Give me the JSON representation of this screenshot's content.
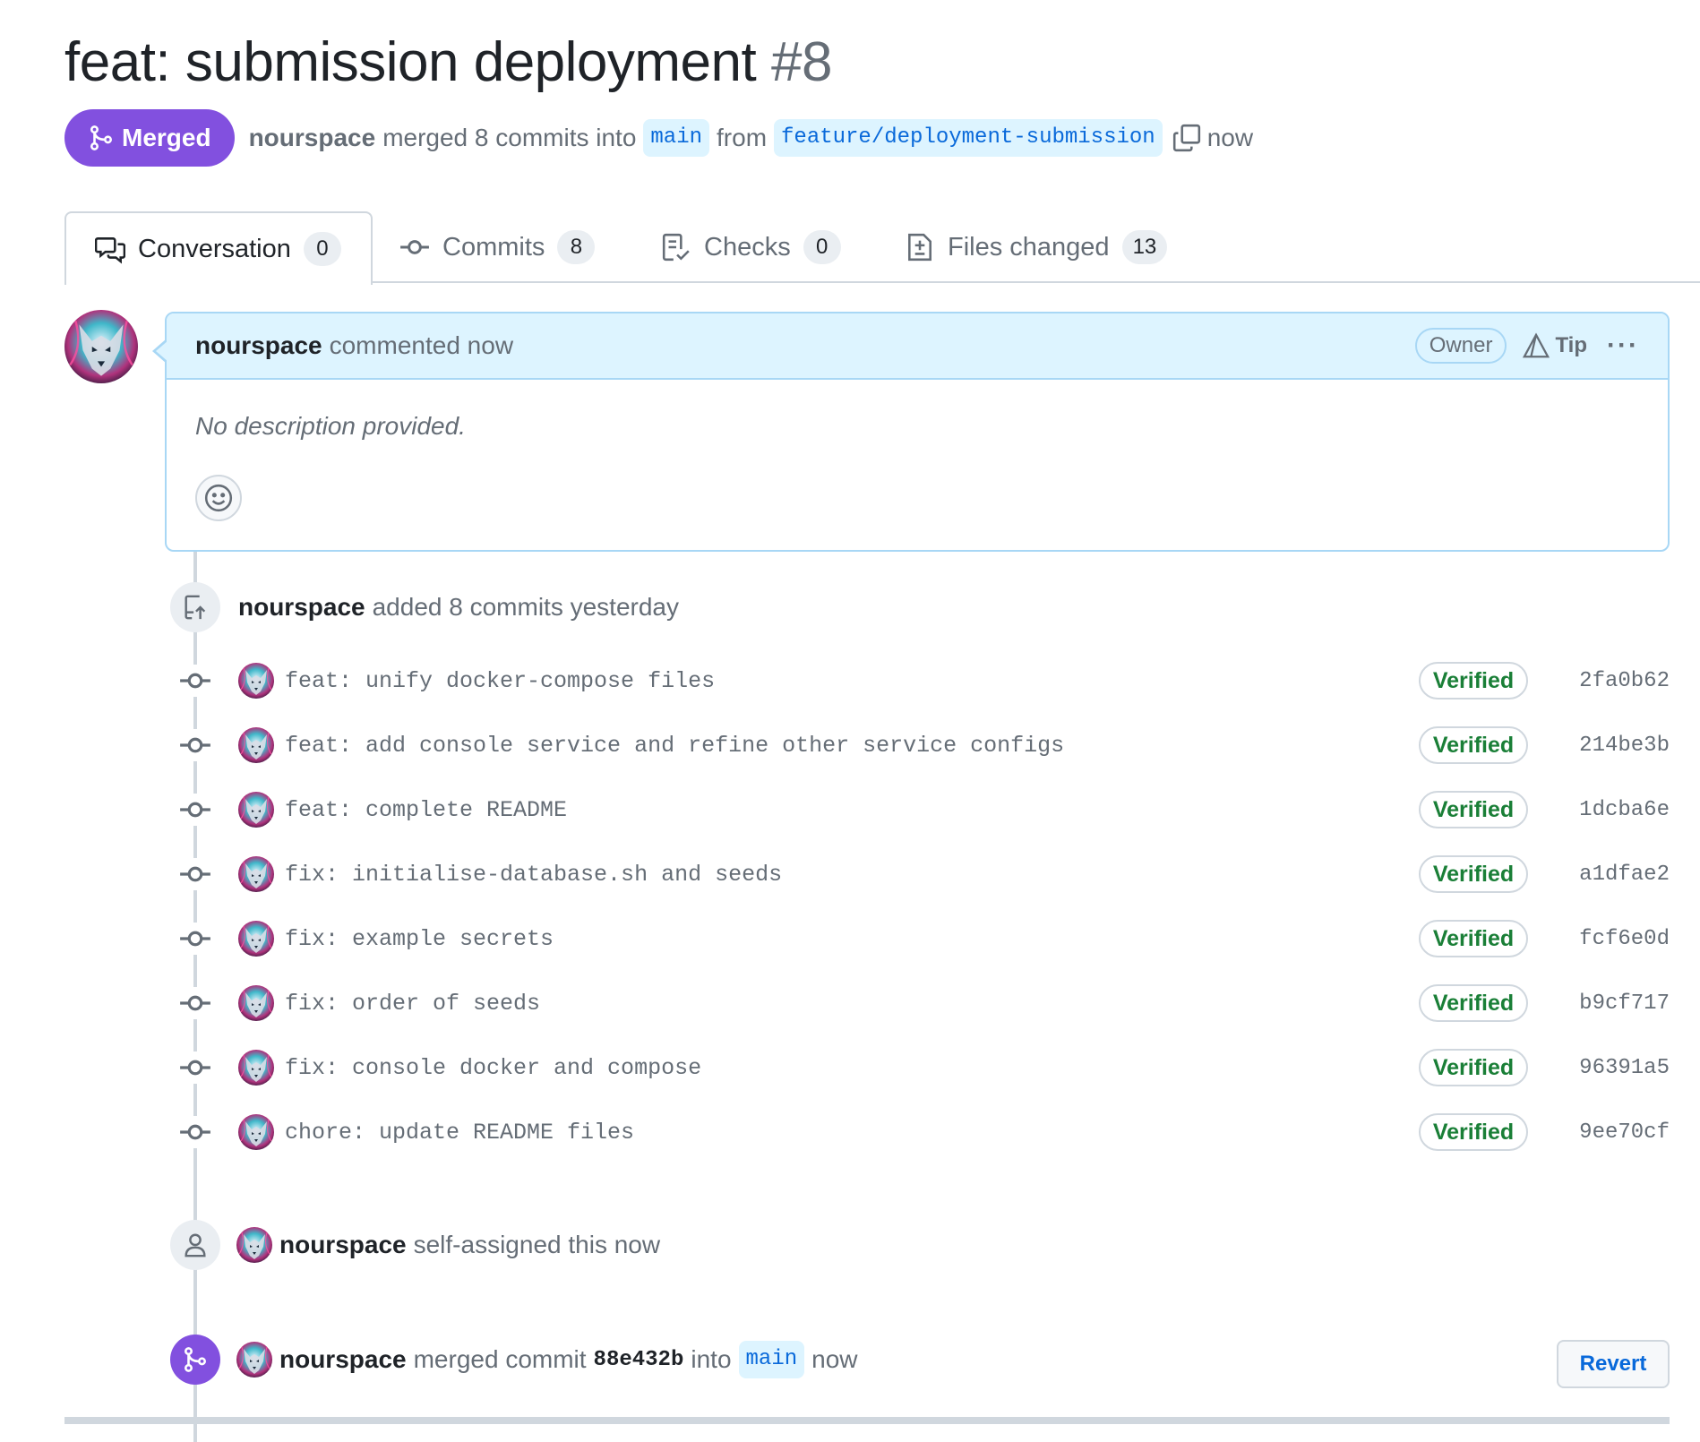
{
  "pr": {
    "title": "feat: submission deployment",
    "number": "#8",
    "state": "Merged",
    "author": "nourspace",
    "merge_text": "merged 8 commits into",
    "base_branch": "main",
    "from_text": "from",
    "head_branch": "feature/deployment-submission",
    "time": "now"
  },
  "tabs": [
    {
      "label": "Conversation",
      "count": "0",
      "icon": "comment-discussion-icon"
    },
    {
      "label": "Commits",
      "count": "8",
      "icon": "git-commit-icon"
    },
    {
      "label": "Checks",
      "count": "0",
      "icon": "checklist-icon"
    },
    {
      "label": "Files changed",
      "count": "13",
      "icon": "file-diff-icon"
    }
  ],
  "comment": {
    "author": "nourspace",
    "action": "commented now",
    "badge": "Owner",
    "tip": "Tip",
    "more": "···",
    "body": "No description provided."
  },
  "commits_event": {
    "author": "nourspace",
    "text": "added 8 commits yesterday"
  },
  "commits": [
    {
      "message": "feat: unify docker-compose files",
      "verified": "Verified",
      "sha": "2fa0b62"
    },
    {
      "message": "feat: add console service and refine other service configs",
      "verified": "Verified",
      "sha": "214be3b"
    },
    {
      "message": "feat: complete README",
      "verified": "Verified",
      "sha": "1dcba6e"
    },
    {
      "message": "fix: initialise-database.sh and seeds",
      "verified": "Verified",
      "sha": "a1dfae2"
    },
    {
      "message": "fix: example secrets",
      "verified": "Verified",
      "sha": "fcf6e0d"
    },
    {
      "message": "fix: order of seeds",
      "verified": "Verified",
      "sha": "b9cf717"
    },
    {
      "message": "fix: console docker and compose",
      "verified": "Verified",
      "sha": "96391a5"
    },
    {
      "message": "chore: update README files",
      "verified": "Verified",
      "sha": "9ee70cf"
    }
  ],
  "assign_event": {
    "author": "nourspace",
    "text": "self-assigned this now"
  },
  "merge_event": {
    "author": "nourspace",
    "text": "merged commit",
    "sha": "88e432b",
    "into": "into",
    "branch": "main",
    "time": "now",
    "revert_label": "Revert"
  },
  "colors": {
    "merged_purple": "#8250df",
    "verified_green": "#1a7f37",
    "link_blue": "#0969da",
    "comment_header_bg": "#ddf4ff"
  }
}
